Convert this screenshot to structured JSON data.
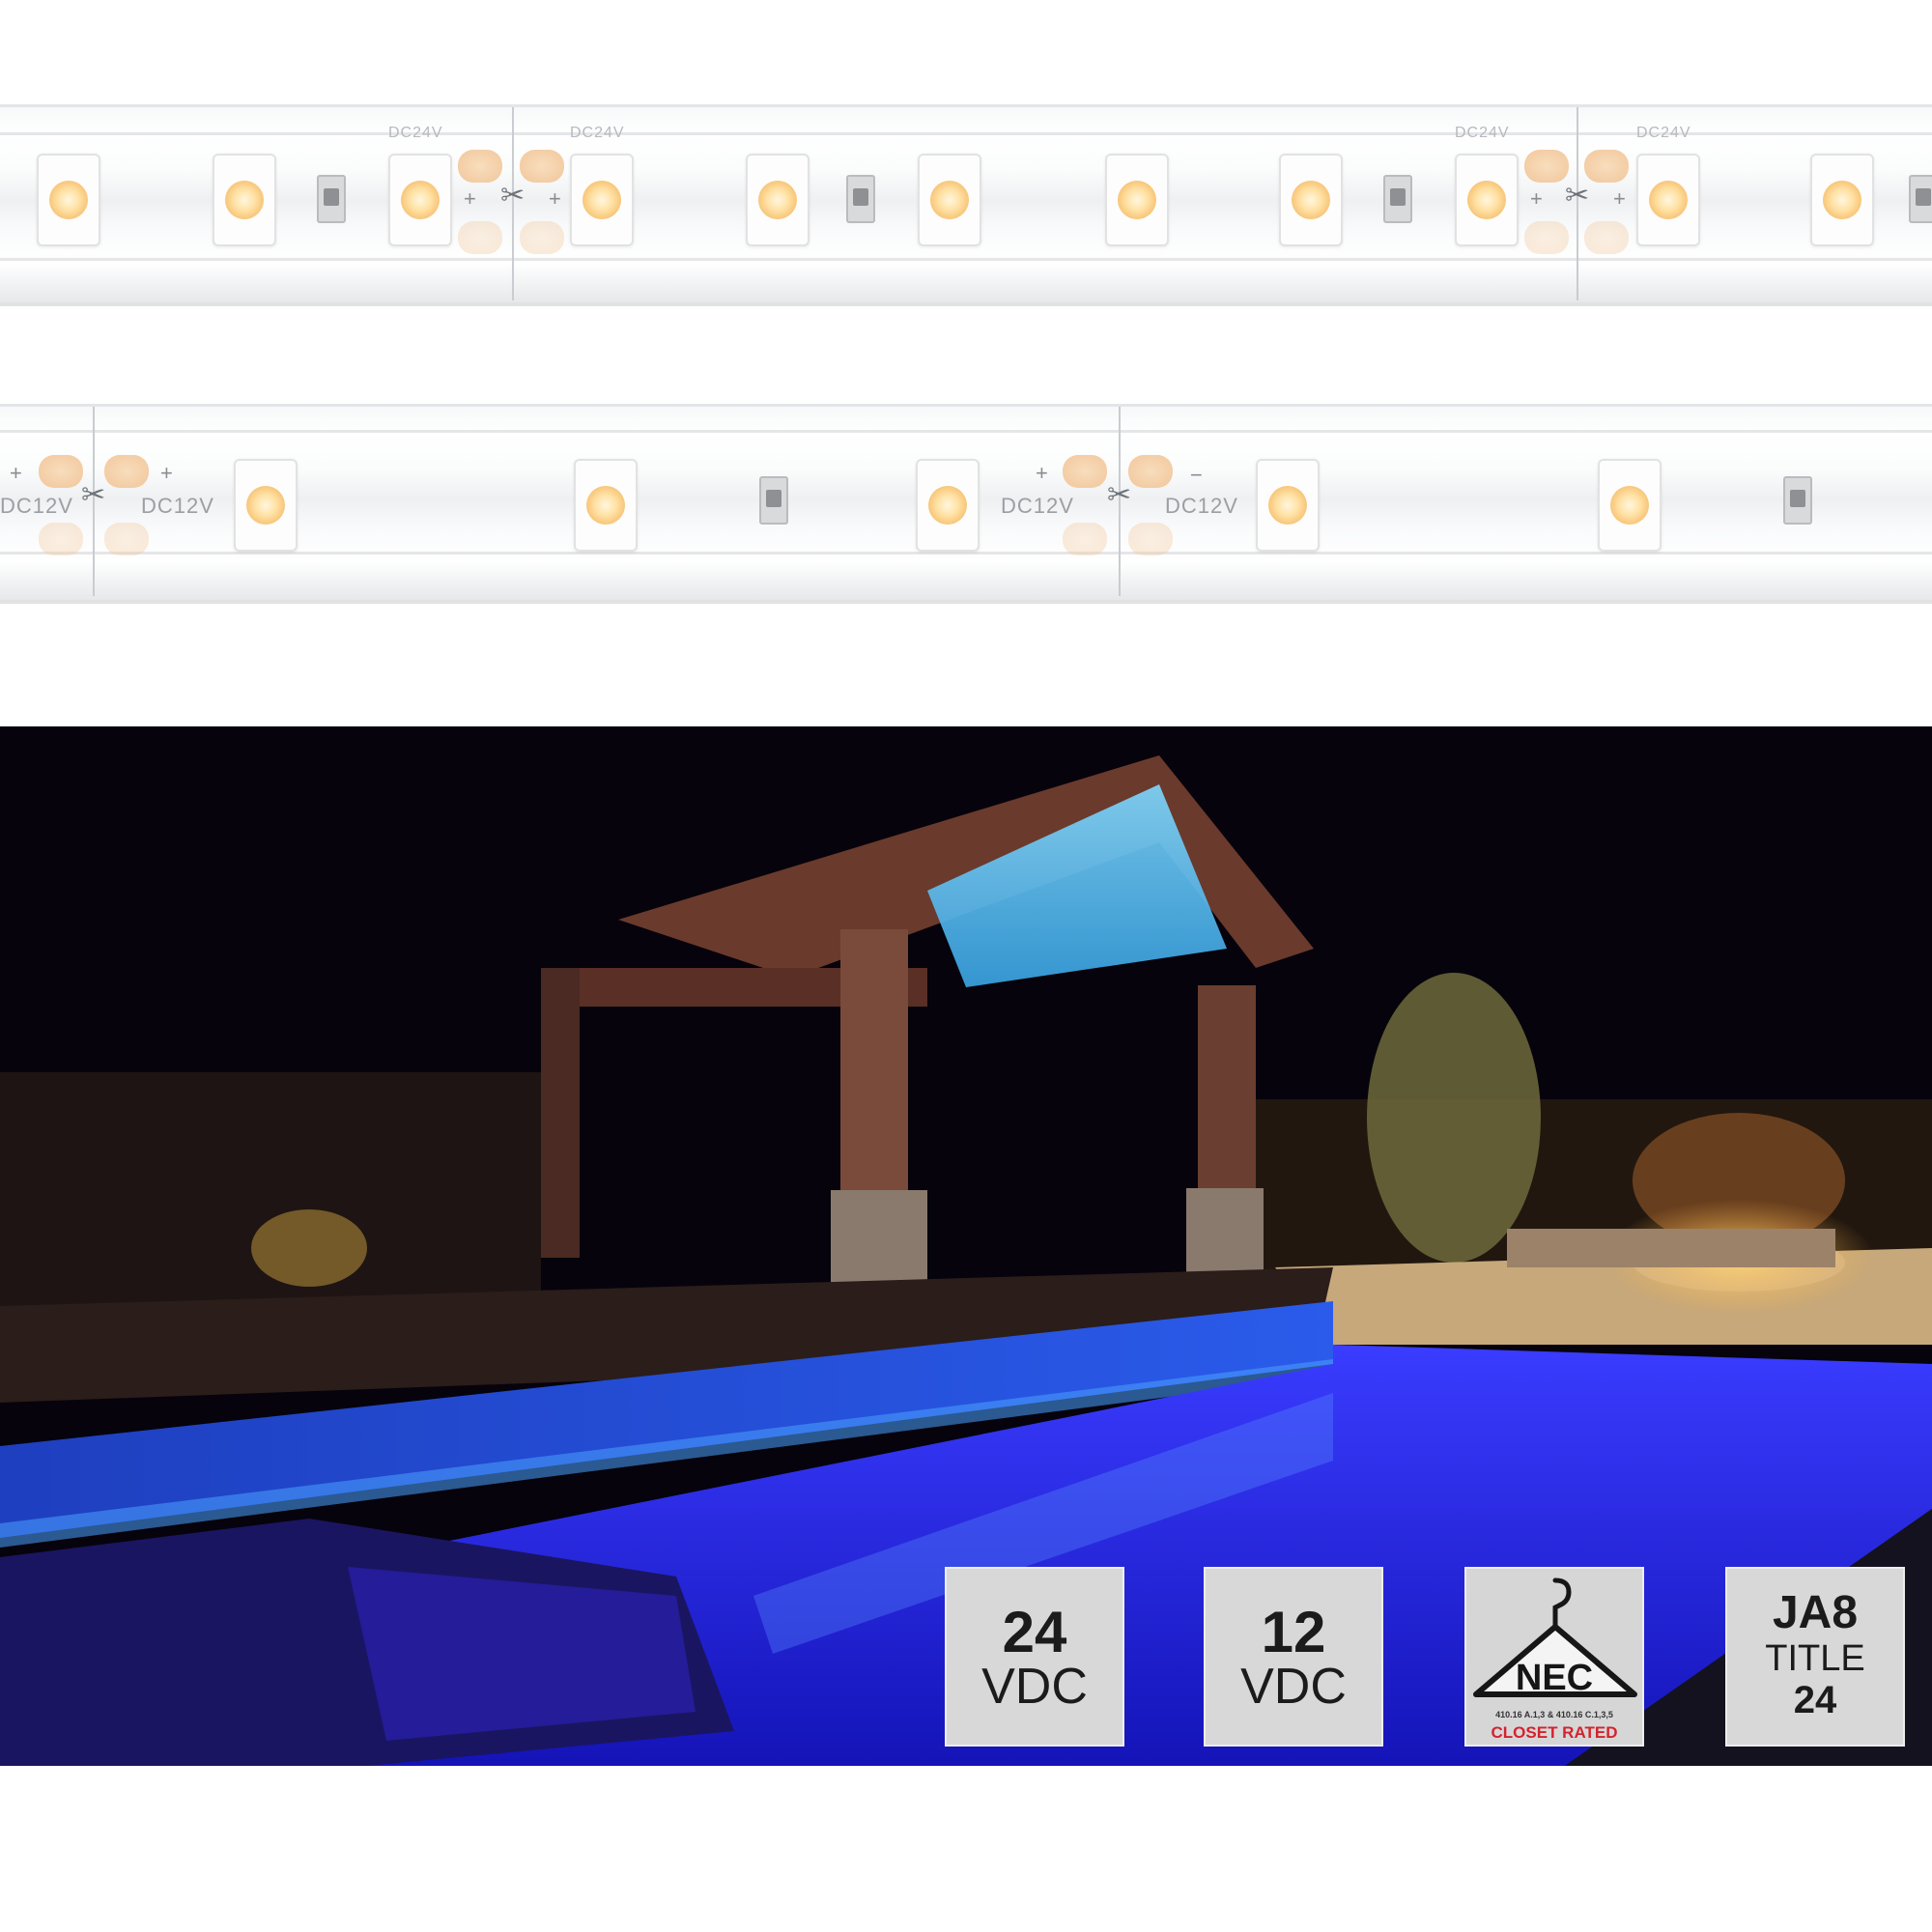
{
  "strips": {
    "top_label": "DC24V",
    "bottom_label": "DC12V",
    "plus": "+",
    "minus": "−"
  },
  "photo": {
    "scene": "backyard-pool-night"
  },
  "badges": [
    {
      "value": "24",
      "unit": "VDC"
    },
    {
      "value": "12",
      "unit": "VDC"
    },
    {
      "word": "NEC",
      "code": "410.16 A.1,3 & 410.16 C.1,3,5",
      "rated": "CLOSET RATED"
    },
    {
      "line1": "JA8",
      "line2": "TITLE",
      "line3": "24"
    }
  ],
  "colors": {
    "led_warm": "#f8c679",
    "pool_blue": "#2a2df0",
    "nec_red": "#d3232e",
    "badge_grey": "#d8d8d8"
  }
}
